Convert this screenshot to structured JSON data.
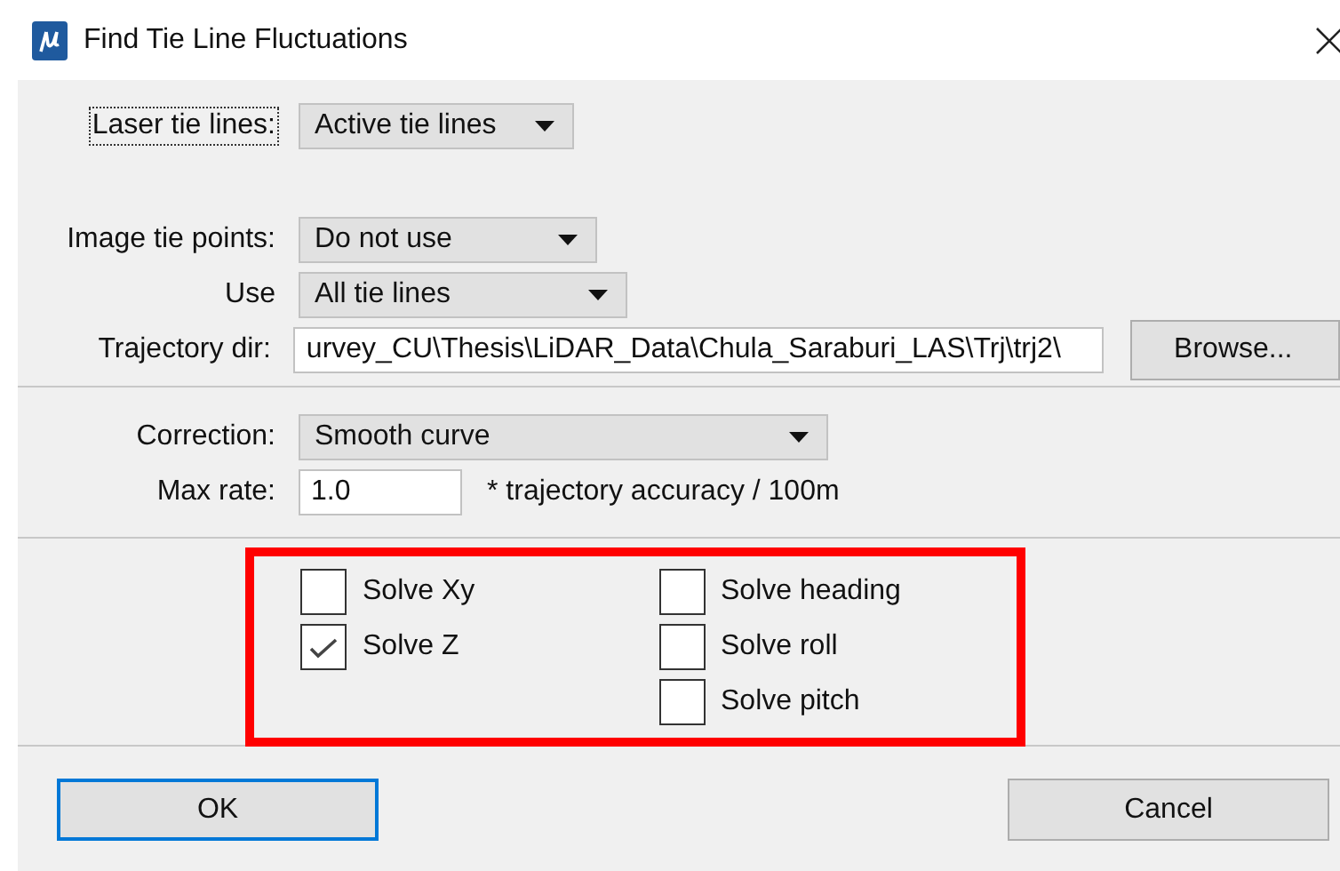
{
  "window": {
    "title": "Find Tie Line Fluctuations"
  },
  "source": [
    {
      "kind": "select",
      "label": "Laser tie lines:",
      "value": "Active tie lines",
      "focused": true
    },
    {
      "kind": "gap"
    },
    {
      "kind": "select",
      "label": "Image tie points:",
      "value": "Do not use",
      "focused": false
    },
    {
      "kind": "select",
      "label": "Use",
      "value": "All tie lines",
      "focused": false
    },
    {
      "kind": "path",
      "label": "Trajectory dir:",
      "value": "urvey_CU\\Thesis\\LiDAR_Data\\Chula_Saraburi_LAS\\Trj\\trj2\\",
      "button": "Browse...",
      "focused": false
    }
  ],
  "correction": {
    "label": "Correction:",
    "value": "Smooth curve"
  },
  "max_rate": {
    "label": "Max rate:",
    "value": "1.0",
    "note": "* trajectory accuracy / 100m"
  },
  "solve_columns": [
    {
      "items": [
        {
          "label": "Solve Xy",
          "checked": false
        },
        {
          "label": "Solve Z",
          "checked": true
        }
      ]
    },
    {
      "items": [
        {
          "label": "Solve heading",
          "checked": false
        },
        {
          "label": "Solve roll",
          "checked": false
        },
        {
          "label": "Solve pitch",
          "checked": false
        }
      ]
    }
  ],
  "buttons": [
    {
      "label": "OK",
      "default": true
    },
    {
      "label": "Cancel",
      "default": false
    }
  ]
}
